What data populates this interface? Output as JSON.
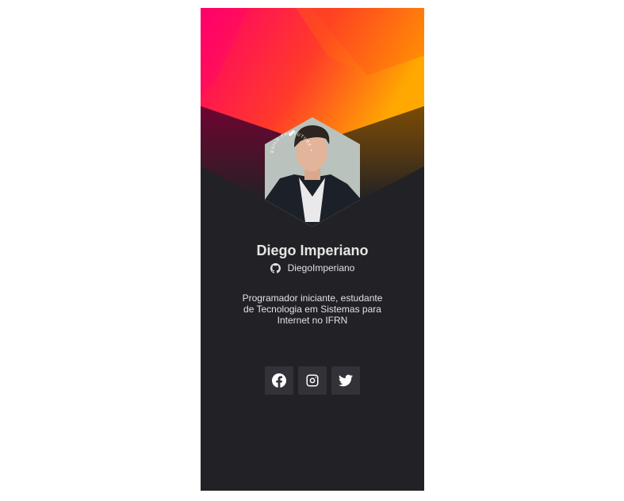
{
  "profile": {
    "name": "Diego Imperiano",
    "github_user": "DiegoImperiano",
    "bio": "Programador iniciante, estudante de Tecnologia em Sistemas para Internet no IFRN",
    "badge_text": "BUILD THE FUTURE • ROCKETSEAT •"
  },
  "socials": [
    {
      "name": "facebook-icon"
    },
    {
      "name": "instagram-icon"
    },
    {
      "name": "twitter-icon"
    }
  ],
  "colors": {
    "card_bg": "#222125",
    "gradient_start": "#FF0068",
    "gradient_end": "#FFA900",
    "social_button_bg": "#323238",
    "text": "#E1E1E6"
  }
}
